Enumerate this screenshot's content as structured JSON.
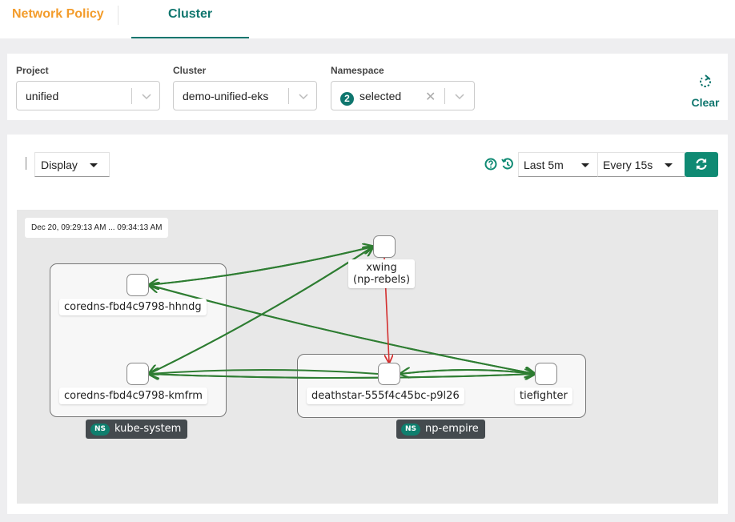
{
  "tabs": [
    {
      "label": "Network Policy",
      "active": false
    },
    {
      "label": "Cluster",
      "active": true
    }
  ],
  "filters": {
    "project": {
      "label": "Project",
      "value": "unified"
    },
    "cluster": {
      "label": "Cluster",
      "value": "demo-unified-eks"
    },
    "namespace": {
      "label": "Namespace",
      "count": "2",
      "value": "selected"
    },
    "clear_label": "Clear"
  },
  "toolbar": {
    "display_label": "Display",
    "time_range": "Last 5m",
    "refresh_interval": "Every 15s"
  },
  "colors": {
    "accent": "#0f766e",
    "tab_inactive": "#f39c2b",
    "allowed_edge": "#2e7d32",
    "denied_edge": "#d32f2f"
  },
  "graph": {
    "time_window": "Dec 20, 09:29:13 AM ... 09:34:13 AM",
    "ns_tag_prefix": "NS",
    "namespaces": [
      {
        "id": "kube-system",
        "name": "kube-system"
      },
      {
        "id": "np-empire",
        "name": "np-empire"
      }
    ],
    "nodes": [
      {
        "id": "xwing",
        "label_line1": "xwing",
        "label_line2": "(np-rebels)",
        "namespace": "np-rebels"
      },
      {
        "id": "hhndg",
        "label": "coredns-fbd4c9798-hhndg",
        "namespace": "kube-system"
      },
      {
        "id": "kmfrm",
        "label": "coredns-fbd4c9798-kmfrm",
        "namespace": "kube-system"
      },
      {
        "id": "deathstar",
        "label": "deathstar-555f4c45bc-p9l26",
        "namespace": "np-empire"
      },
      {
        "id": "tiefighter",
        "label": "tiefighter",
        "namespace": "np-empire"
      }
    ],
    "edges": [
      {
        "from": "hhndg",
        "to": "xwing",
        "status": "allowed"
      },
      {
        "from": "xwing",
        "to": "hhndg",
        "status": "allowed"
      },
      {
        "from": "kmfrm",
        "to": "xwing",
        "status": "allowed"
      },
      {
        "from": "xwing",
        "to": "kmfrm",
        "status": "allowed"
      },
      {
        "from": "hhndg",
        "to": "tiefighter",
        "status": "allowed"
      },
      {
        "from": "tiefighter",
        "to": "hhndg",
        "status": "allowed"
      },
      {
        "from": "kmfrm",
        "to": "tiefighter",
        "status": "allowed"
      },
      {
        "from": "tiefighter",
        "to": "kmfrm",
        "status": "allowed"
      },
      {
        "from": "deathstar",
        "to": "kmfrm",
        "status": "allowed"
      },
      {
        "from": "tiefighter",
        "to": "deathstar",
        "status": "allowed"
      },
      {
        "from": "deathstar",
        "to": "tiefighter",
        "status": "allowed"
      },
      {
        "from": "xwing",
        "to": "deathstar",
        "status": "denied"
      }
    ]
  }
}
